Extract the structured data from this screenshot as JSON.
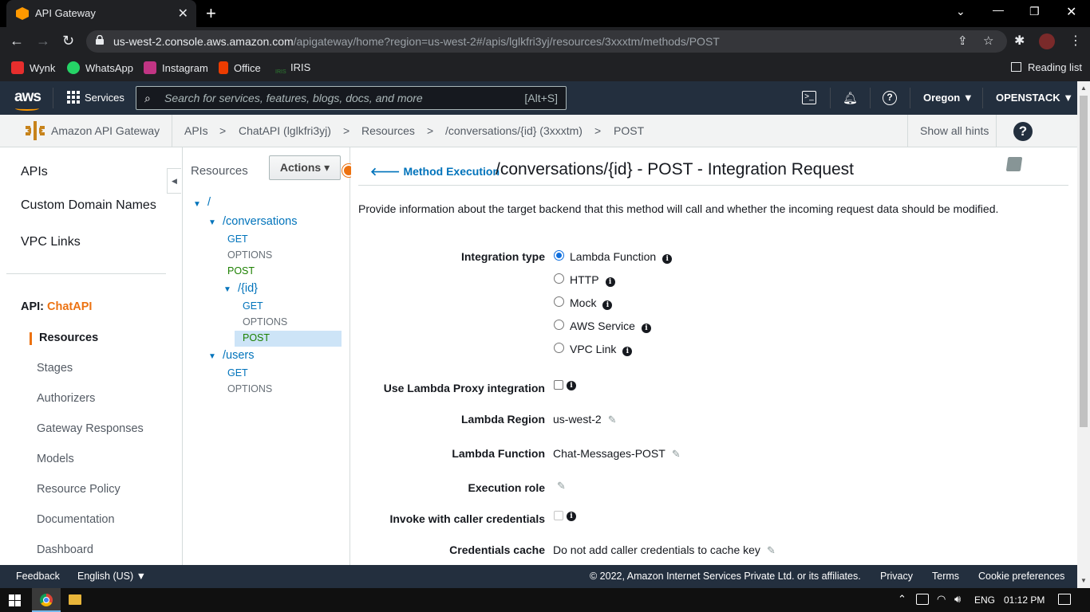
{
  "browser": {
    "tab_title": "API Gateway",
    "url_host": "us-west-2.console.aws.amazon.com",
    "url_path": "/apigateway/home?region=us-west-2#/apis/lglkfri3yj/resources/3xxxtm/methods/POST",
    "bookmarks": [
      {
        "label": "Wynk",
        "color": "#e62e2d"
      },
      {
        "label": "WhatsApp",
        "color": "#25d366"
      },
      {
        "label": "Instagram",
        "color": "#c13584"
      },
      {
        "label": "Office",
        "color": "#eb3c00"
      },
      {
        "label": "IRIS",
        "color": "#2e7d32"
      }
    ],
    "reading_list": "Reading list"
  },
  "aws_header": {
    "logo": "aws",
    "services": "Services",
    "search_placeholder": "Search for services, features, blogs, docs, and more",
    "search_shortcut": "[Alt+S]",
    "region": "Oregon ▼",
    "account": "OPENSTACK ▼"
  },
  "breadcrumb": {
    "service": "Amazon API Gateway",
    "items": [
      "APIs",
      "ChatAPI (lglkfri3yj)",
      "Resources",
      "/conversations/{id} (3xxxtm)",
      "POST"
    ],
    "separator": ">",
    "show_hints": "Show all hints"
  },
  "left_nav": {
    "top": [
      "APIs",
      "Custom Domain Names",
      "VPC Links"
    ],
    "api_prefix": "API:",
    "api_name": "ChatAPI",
    "items": [
      "Resources",
      "Stages",
      "Authorizers",
      "Gateway Responses",
      "Models",
      "Resource Policy",
      "Documentation",
      "Dashboard"
    ]
  },
  "tree": {
    "title": "Resources",
    "actions": "Actions ▾",
    "root": "/",
    "conversations": "/conversations",
    "conversations_methods": [
      "GET",
      "OPTIONS",
      "POST"
    ],
    "id": "/{id}",
    "id_methods": [
      "GET",
      "OPTIONS",
      "POST"
    ],
    "users": "/users",
    "users_methods": [
      "GET",
      "OPTIONS"
    ]
  },
  "main": {
    "back_link": "Method Execution",
    "title": "/conversations/{id} - POST - Integration Request",
    "description": "Provide information about the target backend that this method will call and whether the incoming request data should be modified.",
    "integration_type_label": "Integration type",
    "integration_options": [
      "Lambda Function",
      "HTTP",
      "Mock",
      "AWS Service",
      "VPC Link"
    ],
    "integration_selected": "Lambda Function",
    "proxy_label": "Use Lambda Proxy integration",
    "proxy_checked": false,
    "region_label": "Lambda Region",
    "region_value": "us-west-2",
    "function_label": "Lambda Function",
    "function_value": "Chat-Messages-POST",
    "role_label": "Execution role",
    "invoke_label": "Invoke with caller credentials",
    "invoke_checked": false,
    "cache_label": "Credentials cache",
    "cache_value": "Do not add caller credentials to cache key"
  },
  "footer": {
    "feedback": "Feedback",
    "language": "English (US) ▼",
    "copyright": "© 2022, Amazon Internet Services Private Ltd. or its affiliates.",
    "links": [
      "Privacy",
      "Terms",
      "Cookie preferences"
    ]
  },
  "taskbar": {
    "lang": "ENG",
    "time": "01:12 PM"
  },
  "colors": {
    "aws_nav": "#232f3e",
    "link": "#0073bb",
    "accent_orange": "#ec7211",
    "post_green": "#1d8102"
  }
}
